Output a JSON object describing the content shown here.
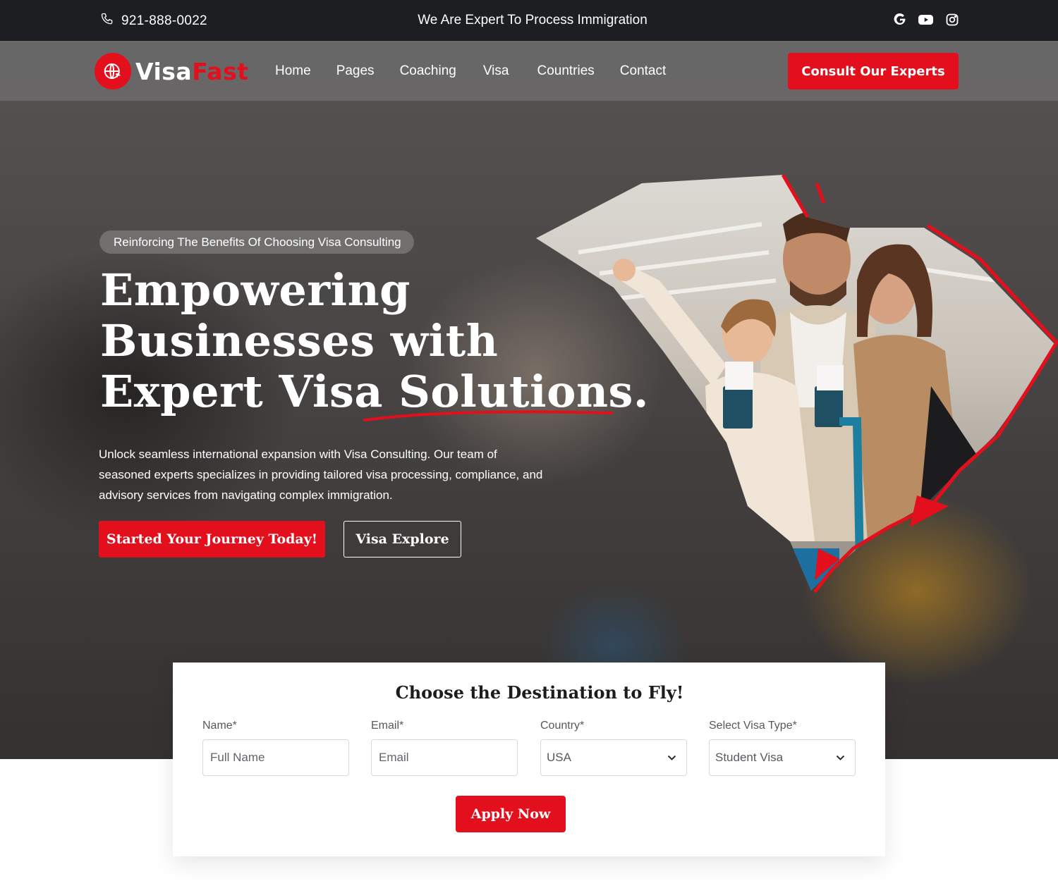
{
  "topbar": {
    "phone": "921-888-0022",
    "tagline": "We Are Expert To Process Immigration",
    "socials": [
      "google-icon",
      "youtube-icon",
      "instagram-icon"
    ]
  },
  "brand": {
    "part1": "Visa",
    "part2": "Fast",
    "accent_color": "#e30f1c"
  },
  "nav": {
    "items": [
      "Home",
      "Pages",
      "Coaching",
      "Visa",
      "Countries",
      "Contact"
    ],
    "cta": "Consult Our Experts"
  },
  "hero": {
    "pill": "Reinforcing The Benefits Of Choosing Visa Consulting",
    "headline_lines": [
      "Empowering",
      "Businesses with",
      "Expert Visa Solutions."
    ],
    "lead": "Unlock seamless international expansion with Visa Consulting. Our team of seasoned experts specializes in providing tailored visa processing, compliance, and advisory services from navigating complex immigration.",
    "primary_button": "Started Your Journey Today!",
    "secondary_button": "Visa Explore"
  },
  "booking": {
    "title": "Choose the Destination to Fly!",
    "fields": [
      {
        "label": "Name*",
        "placeholder": "Full Name"
      },
      {
        "label": "Email*",
        "placeholder": "Email"
      },
      {
        "label": "Country*",
        "value": "USA"
      },
      {
        "label": "Select Visa Type*",
        "value": "Student Visa"
      }
    ],
    "submit": "Apply Now"
  }
}
